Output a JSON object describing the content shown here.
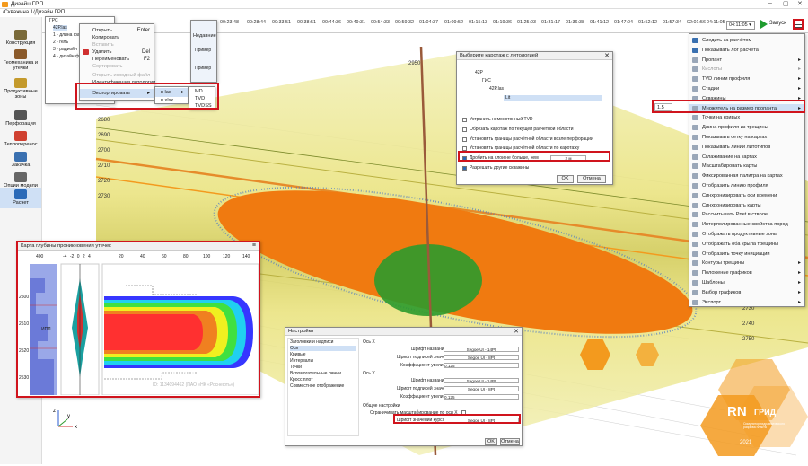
{
  "app": {
    "title": "Дизайн ГРП",
    "breadcrumb": "/Скважина 1/Дизайн ГРП"
  },
  "window_controls": [
    "–",
    "▢",
    "✕"
  ],
  "sidebar": {
    "items": [
      {
        "label": "Конструкция",
        "color": "#7a6a3a"
      },
      {
        "label": "Геомеханика и утечки",
        "color": "#8b5a2b"
      },
      {
        "label": "Продуктивные зоны",
        "color": "#c49a2c"
      },
      {
        "label": "Перфорация",
        "color": "#555555"
      },
      {
        "label": "Теплоперенос",
        "color": "#d04030"
      },
      {
        "label": "Закачка",
        "color": "#3a70b0"
      },
      {
        "label": "Опции модели",
        "color": "#666666"
      },
      {
        "label": "Расчет",
        "color": "#2a6ab8"
      }
    ],
    "active_index": 7
  },
  "timeline": {
    "ticks": [
      "00:23:48",
      "00:28:44",
      "00:33:51",
      "00:38:51",
      "00:44:36",
      "00:49:31",
      "00:54:33",
      "00:59:32",
      "01:04:37",
      "01:09:52",
      "01:15:13",
      "01:19:36",
      "01:25:03",
      "01:31:17",
      "01:36:38",
      "01:41:12",
      "01:47:04",
      "01:52:12",
      "01:57:34",
      "02:01:56",
      "04:11:05"
    ],
    "current": "04:11:05",
    "start_button": "Запуск"
  },
  "file_menu": {
    "tree": [
      "ГРС",
      "42Р.las",
      "1 - длина файла",
      "2 - гель",
      "3 - радиойн",
      "4 - дизайн файл"
    ],
    "items": [
      "Открыть",
      "Копировать",
      "Вставить",
      "Удалить",
      "Переименовать",
      "Сортировать",
      "Открыть исходный файл",
      "Идентификация литологии",
      "Экспортировать"
    ],
    "shortcuts": {
      "Открыть": "Enter",
      "Удалить": "Del",
      "Переименовать": "F2"
    },
    "submenu": [
      "в las",
      "в xlsx"
    ],
    "subsubmenu": [
      "MD",
      "TVD",
      "TVDSS"
    ],
    "side_label": "Недавние",
    "recent": [
      "Пример",
      "Пример"
    ]
  },
  "lithology_dialog": {
    "title": "Выберите каротаж с литологией",
    "tree": [
      "42Р",
      "ГИС",
      "42P.las",
      "Lit"
    ],
    "options": [
      {
        "label": "Устранить немонотонный TVD",
        "checked": false
      },
      {
        "label": "Обрезать каротаж по текущей расчётной области",
        "checked": false
      },
      {
        "label": "Установить границы расчётной области возле перфорации",
        "checked": false
      },
      {
        "label": "Установить границы расчётной области по каротажу",
        "checked": false
      },
      {
        "label": "Дробить на слои не больше, чем",
        "checked": true,
        "value": "2 м"
      },
      {
        "label": "Разрешить другие скважины",
        "checked": true
      }
    ],
    "ok": "OK",
    "cancel": "Отмена"
  },
  "depth_labels": {
    "left": [
      "2680",
      "2690",
      "2700",
      "2710",
      "2720",
      "2730"
    ],
    "right": [
      "2680",
      "2690",
      "2700",
      "2710",
      "2720",
      "2730",
      "2740",
      "2750"
    ],
    "axis_top": "2950"
  },
  "right_menu": {
    "items": [
      {
        "label": "Следить за расчётом",
        "icon": "#3a70b0"
      },
      {
        "label": "Показывать лог расчёта",
        "icon": "#3a70b0"
      },
      {
        "label": "Пропант",
        "arrow": true
      },
      {
        "label": "Кислоты",
        "arrow": true,
        "disabled": true
      },
      {
        "label": "TVD линии профиля",
        "arrow": true
      },
      {
        "label": "Стадии",
        "arrow": true
      },
      {
        "label": "Скважины",
        "arrow": true
      },
      {
        "label": "Множитель на размер пропанта",
        "arrow": true,
        "value": "1.5"
      },
      {
        "label": "Точки на кривых"
      },
      {
        "label": "Длина профиля из трещины"
      },
      {
        "label": "Показывать сетку на картах"
      },
      {
        "label": "Показывать линии литотипов"
      },
      {
        "label": "Сглаживание на картах"
      },
      {
        "label": "Масштабировать карты"
      },
      {
        "label": "Фиксированная палитра на картах"
      },
      {
        "label": "Отобразить линию профиля"
      },
      {
        "label": "Синхронизировать оси времени"
      },
      {
        "label": "Синхронизировать карты"
      },
      {
        "label": "Рассчитывать Pnet в стволе"
      },
      {
        "label": "Интерполированные свойства пород"
      },
      {
        "label": "Отображать продуктивные зоны"
      },
      {
        "label": "Отображать оба крыла трещины"
      },
      {
        "label": "Отобразить точку инициации"
      },
      {
        "label": "Контуры трещины",
        "arrow": true
      },
      {
        "label": "Положение графиков",
        "arrow": true
      },
      {
        "label": "Шаблоны",
        "arrow": true
      },
      {
        "label": "Выбор графиков",
        "arrow": true
      },
      {
        "label": "Экспорт",
        "arrow": true
      }
    ]
  },
  "leak_map": {
    "title": "Карта глубины проникновения утечек",
    "depth_ticks": [
      "2500",
      "2510",
      "2520",
      "2530"
    ],
    "top_axis_left": [
      "400"
    ],
    "top_axis_mid": [
      "-4",
      "-2",
      "0",
      "2",
      "4"
    ],
    "top_axis_right": [
      "20",
      "40",
      "60",
      "80",
      "100",
      "120",
      "140"
    ],
    "label_ipl": "ИПЛ",
    "watermark": "РН-ГРИД 2021",
    "watermark_sub": "ID: 1134094462 (ПАО «НК «Роснефть»)"
  },
  "settings_dialog": {
    "title": "Настройки",
    "tree": [
      "Заголовки и надписи",
      "Оси",
      "Кривые",
      "Интервалы",
      "Точки",
      "Вспомогательные линии",
      "Кросс плот",
      "Совместное отображение"
    ],
    "axis_x": "Ось Х",
    "axis_y": "Ось Y",
    "general": "Общие настройки",
    "rows_x": [
      {
        "label": "Шрифт названия",
        "value": "Segoe UI - 14Pt"
      },
      {
        "label": "Шрифт подписей значений",
        "value": "Segoe UI - 8Pt"
      },
      {
        "label": "Коэффициент увеличения",
        "value": "0.125"
      }
    ],
    "rows_y": [
      {
        "label": "Шрифт названия",
        "value": "Segoe UI - 14Pt"
      },
      {
        "label": "Шрифт подписей значений",
        "value": "Segoe UI - 8Pt"
      },
      {
        "label": "Коэффициент увеличения",
        "value": "0.125"
      }
    ],
    "scale_limit": "Ограничивать масштабирование по оси Х",
    "cursor_font": {
      "label": "Шрифт значений курсора",
      "value": "Segoe UI - 8Pt"
    },
    "ok": "OK",
    "cancel": "Отмена"
  },
  "logo": {
    "brand": "RN",
    "brand2": "ГРИД",
    "year": "2021",
    "tag": "Симулятор гидравлического разрыва пласта"
  },
  "xy_axes": {
    "x": "x",
    "y": "y",
    "z": "z"
  },
  "colors": {
    "accent_red": "#d0141d",
    "proppant_orange": "#f07a10",
    "fluid_green": "#2c9a2c",
    "layer_yellow": "#e8e070",
    "logo_orange": "#f39a1e"
  }
}
